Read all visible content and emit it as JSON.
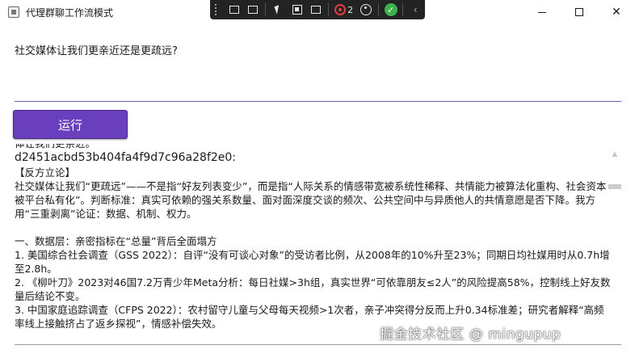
{
  "window": {
    "title": "代理群聊工作流模式",
    "icon": "app-window-icon",
    "controls": {
      "minimize": "minimize-icon",
      "maximize": "maximize-icon",
      "close": "✕"
    }
  },
  "debug_toolbar": {
    "error_count": "2",
    "icons": [
      "live-visual-tree-icon",
      "video-icon",
      "select-element-icon",
      "display-layout-adorners-icon",
      "track-focus-icon",
      "error-icon",
      "accessibility-icon",
      "checkmark-icon",
      "collapse-chevron-icon"
    ]
  },
  "prompt": {
    "text": "社交媒体让我们更亲近还是更疏远?"
  },
  "run_button": {
    "label": "运行",
    "color": "#6a3fbd"
  },
  "output": {
    "cut_line": "体让我们更亲近。",
    "hash": "d2451acbd53b404fa4f9d7c96a28f2e0:",
    "section_header": "【反方立论】",
    "paragraph1": "社交媒体让我们“更疏远”——不是指“好友列表变少”，而是指“人际关系的情感带宽被系统性稀释、共情能力被算法化重构、社会资本被平台私有化”。判断标准：真实可依赖的强关系数量、面对面深度交谈的频次、公共空间中与异质他人的共情意愿是否下降。我方用“三重剥离”论证：数据、机制、权力。",
    "subheading": "一、数据层：亲密指标在“总量”背后全面塌方",
    "items": [
      "1. 美国综合社会调查（GSS 2022）：自评“没有可谈心对象”的受访者比例，从2008年的10%升至23%；同期日均社媒用时从0.7h增至2.8h。",
      "2. 《柳叶刀》2023对46国7.2万青少年Meta分析：每日社媒>3h组，真实世界“可依靠朋友≤2人”的风险提高58%，控制线上好友数量后结论不变。",
      "3. 中国家庭追踪调查（CFPS 2022）：农村留守儿童与父母每天视频>1次者，亲子冲突得分反而上升0.34标准差；研究者解释“高频率线上接触挤占了返乡探视”，情感补偿失效。"
    ]
  },
  "scrollbar": {
    "up_icon": "▲"
  },
  "watermark": {
    "text": "掘金技术社区 @ mingupup"
  }
}
